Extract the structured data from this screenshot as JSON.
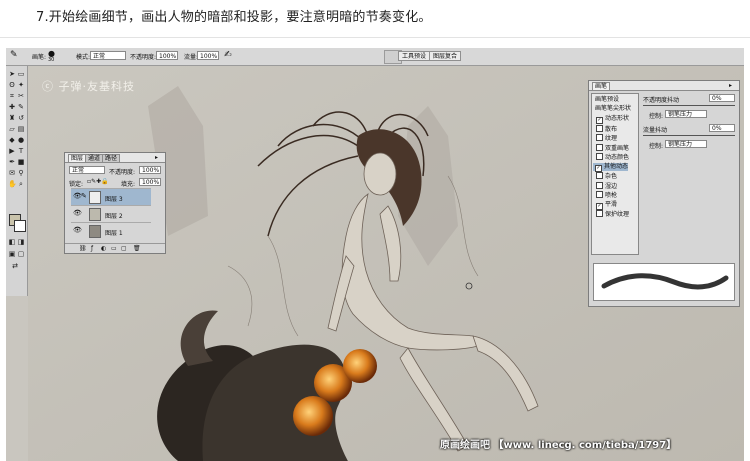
{
  "caption": "7.开始绘画细节，画出人物的暗部和投影，要注意明暗的节奏变化。",
  "options_bar": {
    "brush_label": "画笔:",
    "brush_size": "30",
    "mode_label": "模式:",
    "mode_value": "正常",
    "opacity_label": "不透明度:",
    "opacity_value": "100%",
    "flow_label": "流量:",
    "flow_value": "100%",
    "tab_tool_presets": "工具预设",
    "tab_layer_comps": "图层复合"
  },
  "watermark": "ⓒ 子弹·友基科技",
  "layers_panel": {
    "tabs": [
      "图层",
      "通道",
      "路径"
    ],
    "blend_mode": "正常",
    "opacity_label": "不透明度:",
    "opacity_value": "100%",
    "lock_label": "锁定:",
    "fill_label": "填充:",
    "fill_value": "100%",
    "layers": [
      {
        "name": "图层 3",
        "active": true
      },
      {
        "name": "图层 2",
        "active": false
      },
      {
        "name": "图层 1",
        "active": false
      }
    ]
  },
  "brushes_panel": {
    "title": "画笔",
    "presets_label": "画笔预设",
    "tip_shape_label": "画笔笔尖形状",
    "options": [
      {
        "label": "动态形状",
        "checked": true
      },
      {
        "label": "散布",
        "checked": false
      },
      {
        "label": "纹理",
        "checked": false
      },
      {
        "label": "双重画笔",
        "checked": false
      },
      {
        "label": "动态颜色",
        "checked": false
      },
      {
        "label": "其他动态",
        "checked": true,
        "active": true
      },
      {
        "label": "杂色",
        "checked": false
      },
      {
        "label": "湿边",
        "checked": false
      },
      {
        "label": "喷枪",
        "checked": false
      },
      {
        "label": "平滑",
        "checked": true
      },
      {
        "label": "保护纹理",
        "checked": false
      }
    ],
    "opacity_jitter_label": "不透明度抖动",
    "opacity_jitter_value": "0%",
    "control_label": "控制:",
    "control_value": "钢笔压力",
    "flow_jitter_label": "流量抖动",
    "flow_jitter_value": "0%",
    "control2_value": "钢笔压力"
  },
  "footer": {
    "site_name": "原画绘画吧",
    "url": "【www. linecg. com/tieba/1797】"
  },
  "colors": {
    "canvas": "#c6c3bb",
    "panel": "#d6d6d6",
    "selected_layer": "#9fb7cf"
  }
}
